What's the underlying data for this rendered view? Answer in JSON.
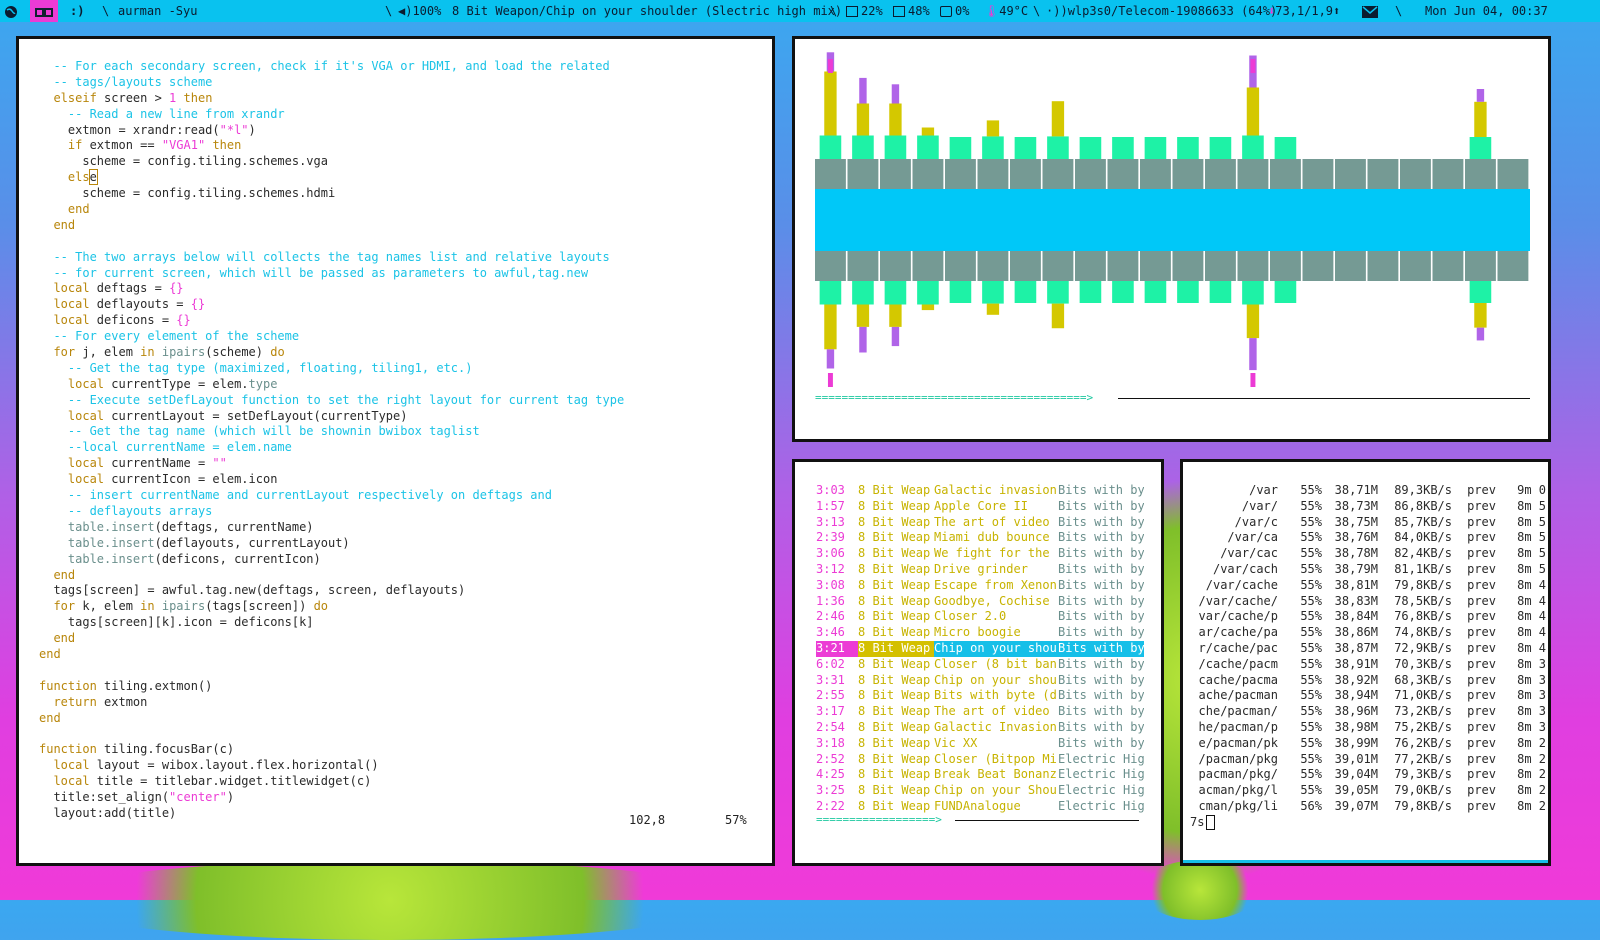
{
  "topbar": {
    "ws1_icon": "globe-icon",
    "ws2_icon": "glasses-icon",
    "ws3_text": ":)",
    "sep": "\\",
    "command": "aurman -Syu",
    "volume": "100%",
    "now_playing": "8 Bit Weapon/Chip on your shoulder (Slectric high mix)",
    "cpu": "22%",
    "mem": "48%",
    "swap": "0%",
    "temp": "49°C",
    "wifi": "wlp3s0/Telecom-19086633 (64%)",
    "net": "73,1/1,9",
    "date": "Mon Jun 04, 00:37",
    "accent_color": "#09c2ef",
    "active_ws_color": "#ec3bd5"
  },
  "editor": {
    "lines": [
      [
        [
          "c",
          "  -- For each secondary screen, check if it's VGA or HDMI, and load the related"
        ]
      ],
      [
        [
          "c",
          "  -- tags/layouts scheme"
        ]
      ],
      [
        [
          "k",
          "  elseif"
        ],
        [
          "t",
          " screen > "
        ],
        [
          "s",
          "1"
        ],
        [
          "t",
          " "
        ],
        [
          "k",
          "then"
        ]
      ],
      [
        [
          "c",
          "    -- Read a new line from xrandr"
        ]
      ],
      [
        [
          "t",
          "    extmon = xrandr:read("
        ],
        [
          "s",
          "\"*l\""
        ],
        [
          "t",
          ")"
        ]
      ],
      [
        [
          "k",
          "    if"
        ],
        [
          "t",
          " extmon == "
        ],
        [
          "s",
          "\"VGA1\""
        ],
        [
          "t",
          " "
        ],
        [
          "k",
          "then"
        ]
      ],
      [
        [
          "t",
          "      scheme = config.tiling.schemes.vga"
        ]
      ],
      [
        [
          "k",
          "    els"
        ],
        [
          "cur",
          "e"
        ]
      ],
      [
        [
          "t",
          "      scheme = config.tiling.schemes.hdmi"
        ]
      ],
      [
        [
          "k",
          "    end"
        ]
      ],
      [
        [
          "k",
          "  end"
        ]
      ],
      [
        [
          "t",
          ""
        ]
      ],
      [
        [
          "c",
          "  -- The two arrays below will collects the tag names list and relative layouts"
        ]
      ],
      [
        [
          "c",
          "  -- for current screen, which will be passed as parameters to awful,tag.new"
        ]
      ],
      [
        [
          "k",
          "  local"
        ],
        [
          "t",
          " deftags = "
        ],
        [
          "s",
          "{}"
        ]
      ],
      [
        [
          "k",
          "  local"
        ],
        [
          "t",
          " deflayouts = "
        ],
        [
          "s",
          "{}"
        ]
      ],
      [
        [
          "k",
          "  local"
        ],
        [
          "t",
          " deficons = "
        ],
        [
          "s",
          "{}"
        ]
      ],
      [
        [
          "c",
          "  -- For every element of the scheme"
        ]
      ],
      [
        [
          "k",
          "  for"
        ],
        [
          "t",
          " j, elem "
        ],
        [
          "k",
          "in"
        ],
        [
          "t",
          " "
        ],
        [
          "d",
          "ipairs"
        ],
        [
          "t",
          "(scheme) "
        ],
        [
          "k",
          "do"
        ]
      ],
      [
        [
          "c",
          "    -- Get the tag type (maximized, floating, tiling1, etc.)"
        ]
      ],
      [
        [
          "k",
          "    local"
        ],
        [
          "t",
          " currentType = elem."
        ],
        [
          "d",
          "type"
        ]
      ],
      [
        [
          "c",
          "    -- Execute setDefLayout function to set the right layout for current tag type"
        ]
      ],
      [
        [
          "k",
          "    local"
        ],
        [
          "t",
          " currentLayout = setDefLayout(currentType)"
        ]
      ],
      [
        [
          "c",
          "    -- Get the tag name (which will be shownin bwibox taglist"
        ]
      ],
      [
        [
          "c",
          "    --local currentName = elem.name"
        ]
      ],
      [
        [
          "k",
          "    local"
        ],
        [
          "t",
          " currentName = "
        ],
        [
          "s",
          "\"\""
        ]
      ],
      [
        [
          "k",
          "    local"
        ],
        [
          "t",
          " currentIcon = elem.icon"
        ]
      ],
      [
        [
          "c",
          "    -- insert currentName and currentLayout respectively on deftags and"
        ]
      ],
      [
        [
          "c",
          "    -- deflayouts arrays"
        ]
      ],
      [
        [
          "d",
          "    table.insert"
        ],
        [
          "t",
          "(deftags, currentName)"
        ]
      ],
      [
        [
          "d",
          "    table.insert"
        ],
        [
          "t",
          "(deflayouts, currentLayout)"
        ]
      ],
      [
        [
          "d",
          "    table.insert"
        ],
        [
          "t",
          "(deficons, currentIcon)"
        ]
      ],
      [
        [
          "k",
          "  end"
        ]
      ],
      [
        [
          "t",
          "  tags[screen] = awful.tag.new(deftags, screen, deflayouts)"
        ]
      ],
      [
        [
          "k",
          "  for"
        ],
        [
          "t",
          " k, elem "
        ],
        [
          "k",
          "in"
        ],
        [
          "t",
          " "
        ],
        [
          "d",
          "ipairs"
        ],
        [
          "t",
          "(tags[screen]) "
        ],
        [
          "k",
          "do"
        ]
      ],
      [
        [
          "t",
          "    tags[screen][k].icon = deficons[k]"
        ]
      ],
      [
        [
          "k",
          "  end"
        ]
      ],
      [
        [
          "k",
          "end"
        ]
      ],
      [
        [
          "t",
          ""
        ]
      ],
      [
        [
          "k",
          "function"
        ],
        [
          "t",
          " tiling.extmon()"
        ]
      ],
      [
        [
          "k",
          "  return"
        ],
        [
          "t",
          " extmon"
        ]
      ],
      [
        [
          "k",
          "end"
        ]
      ],
      [
        [
          "t",
          ""
        ]
      ],
      [
        [
          "k",
          "function"
        ],
        [
          "t",
          " tiling.focusBar(c)"
        ]
      ],
      [
        [
          "k",
          "  local"
        ],
        [
          "t",
          " layout = wibox.layout.flex.horizontal()"
        ]
      ],
      [
        [
          "k",
          "  local"
        ],
        [
          "t",
          " title = titlebar.widget.titlewidget(c)"
        ]
      ],
      [
        [
          "t",
          "  title:set_align("
        ],
        [
          "s",
          "\"center\""
        ],
        [
          "t",
          ")"
        ]
      ],
      [
        [
          "t",
          "  layout:add(title)"
        ]
      ]
    ],
    "position": "102,8",
    "percent": "57%"
  },
  "visualizer": {
    "progress_text": "=========================================>",
    "levels": [
      {
        "a": 0.9,
        "y": 0.9,
        "g": 0.42,
        "s": 0.25,
        "m": 0.25,
        "p": 0.7
      },
      {
        "a": 0.95,
        "y": 0.7,
        "g": 0.42,
        "s": 0.25,
        "m": 0.25,
        "p": 0.5
      },
      {
        "a": 0.9,
        "y": 0.7,
        "g": 0.42,
        "s": 0.25,
        "m": 0.25,
        "p": 0.4
      },
      {
        "a": 0.55,
        "y": 0.55,
        "g": 0.42,
        "s": 0.25,
        "m": 0.25,
        "p": 0.3
      },
      {
        "a": 0.5,
        "y": 0.5,
        "g": 0.42,
        "s": 0.25,
        "m": 0.2,
        "p": 0.2
      },
      {
        "a": 0.6,
        "y": 0.6,
        "g": 0.42,
        "s": 0.25,
        "m": 0.22,
        "p": 0.35
      },
      {
        "a": 0.48,
        "y": 0.48,
        "g": 0.42,
        "s": 0.25,
        "m": 0.2,
        "p": 0.2
      },
      {
        "a": 0.72,
        "y": 0.72,
        "g": 0.42,
        "s": 0.25,
        "m": 0.22,
        "p": 0.4
      },
      {
        "a": 0.5,
        "y": 0.5,
        "g": 0.42,
        "s": 0.25,
        "m": 0.2,
        "p": 0.22
      },
      {
        "a": 0.5,
        "y": 0.5,
        "g": 0.42,
        "s": 0.25,
        "m": 0.2,
        "p": 0.22
      },
      {
        "a": 0.48,
        "y": 0.48,
        "g": 0.42,
        "s": 0.25,
        "m": 0.2,
        "p": 0.28
      },
      {
        "a": 0.5,
        "y": 0.5,
        "g": 0.42,
        "s": 0.25,
        "m": 0.2,
        "p": 0.3
      },
      {
        "a": 0.48,
        "y": 0.48,
        "g": 0.42,
        "s": 0.25,
        "m": 0.2,
        "p": 0.22
      },
      {
        "a": 1.0,
        "y": 0.8,
        "g": 0.42,
        "s": 0.25,
        "m": 0.25,
        "p": 1.0
      },
      {
        "a": 0.48,
        "y": 0.48,
        "g": 0.42,
        "s": 0.25,
        "m": 0.2,
        "p": 0.22
      },
      {
        "a": 0.42,
        "y": 0.42,
        "g": 0.42,
        "s": 0.25,
        "m": 0.2,
        "p": 0.2
      },
      {
        "a": 0.42,
        "y": 0.42,
        "g": 0.42,
        "s": 0.25,
        "m": 0.2,
        "p": 0.2
      },
      {
        "a": 0.42,
        "y": 0.42,
        "g": 0.42,
        "s": 0.25,
        "m": 0.2,
        "p": 0.2
      },
      {
        "a": 0.42,
        "y": 0.42,
        "g": 0.42,
        "s": 0.25,
        "m": 0.2,
        "p": 0.2
      },
      {
        "a": 0.42,
        "y": 0.42,
        "g": 0.42,
        "s": 0.25,
        "m": 0.2,
        "p": 0.2
      },
      {
        "a": 0.85,
        "y": 0.72,
        "g": 0.42,
        "s": 0.25,
        "m": 0.2,
        "p": 0.42
      },
      {
        "a": 0.42,
        "y": 0.42,
        "g": 0.42,
        "s": 0.25,
        "m": 0.2,
        "p": 0.2
      }
    ]
  },
  "playlist": {
    "selected_index": 10,
    "rows": [
      {
        "time": "3:03",
        "artist": "8 Bit Weap",
        "title": "Galactic invasion",
        "album": "Bits with by"
      },
      {
        "time": "1:57",
        "artist": "8 Bit Weap",
        "title": "Apple Core II",
        "album": "Bits with by"
      },
      {
        "time": "3:13",
        "artist": "8 Bit Weap",
        "title": "The art of video",
        "album": "Bits with by"
      },
      {
        "time": "2:39",
        "artist": "8 Bit Weap",
        "title": "Miami dub bounce",
        "album": "Bits with by"
      },
      {
        "time": "3:06",
        "artist": "8 Bit Weap",
        "title": "We fight for the",
        "album": "Bits with by"
      },
      {
        "time": "3:12",
        "artist": "8 Bit Weap",
        "title": "Drive grinder",
        "album": "Bits with by"
      },
      {
        "time": "3:08",
        "artist": "8 Bit Weap",
        "title": "Escape from Xenon",
        "album": "Bits with by"
      },
      {
        "time": "1:36",
        "artist": "8 Bit Weap",
        "title": "Goodbye, Cochise",
        "album": "Bits with by"
      },
      {
        "time": "2:46",
        "artist": "8 Bit Weap",
        "title": "Closer 2.0",
        "album": "Bits with by"
      },
      {
        "time": "3:46",
        "artist": "8 Bit Weap",
        "title": "Micro boogie",
        "album": "Bits with by"
      },
      {
        "time": "3:21",
        "artist": "8 Bit Weap",
        "title": "Chip on your shou",
        "album": "Bits with by"
      },
      {
        "time": "6:02",
        "artist": "8 Bit Weap",
        "title": "Closer (8 bit ban",
        "album": "Bits with by"
      },
      {
        "time": "3:31",
        "artist": "8 Bit Weap",
        "title": "Chip on your shou",
        "album": "Bits with by"
      },
      {
        "time": "2:55",
        "artist": "8 Bit Weap",
        "title": "Bits with byte (d",
        "album": "Bits with by"
      },
      {
        "time": "3:17",
        "artist": "8 Bit Weap",
        "title": "The art of video",
        "album": "Bits with by"
      },
      {
        "time": "2:54",
        "artist": "8 Bit Weap",
        "title": "Galactic Invasion",
        "album": "Bits with by"
      },
      {
        "time": "3:18",
        "artist": "8 Bit Weap",
        "title": "Vic XX",
        "album": "Bits with by"
      },
      {
        "time": "2:52",
        "artist": "8 Bit Weap",
        "title": "Closer (Bitpop Mi",
        "album": "Electric Hig"
      },
      {
        "time": "4:25",
        "artist": "8 Bit Weap",
        "title": "Break Beat Bonanz",
        "album": "Electric Hig"
      },
      {
        "time": "3:25",
        "artist": "8 Bit Weap",
        "title": "Chip on your Shou",
        "album": "Electric Hig"
      },
      {
        "time": "2:22",
        "artist": "8 Bit Weap",
        "title": "FUNDAnalogue",
        "album": "Electric Hig"
      }
    ],
    "progress_text": "==================>"
  },
  "pacman": {
    "rows": [
      {
        "path": "/var",
        "pct": "55%",
        "size": "38,71M",
        "rate": "89,3KB/s",
        "prev": "prev",
        "eta": "9m 0"
      },
      {
        "path": "/var/",
        "pct": "55%",
        "size": "38,73M",
        "rate": "86,8KB/s",
        "prev": "prev",
        "eta": "8m 5"
      },
      {
        "path": "/var/c",
        "pct": "55%",
        "size": "38,75M",
        "rate": "85,7KB/s",
        "prev": "prev",
        "eta": "8m 5"
      },
      {
        "path": "/var/ca",
        "pct": "55%",
        "size": "38,76M",
        "rate": "84,0KB/s",
        "prev": "prev",
        "eta": "8m 5"
      },
      {
        "path": "/var/cac",
        "pct": "55%",
        "size": "38,78M",
        "rate": "82,4KB/s",
        "prev": "prev",
        "eta": "8m 5"
      },
      {
        "path": "/var/cach",
        "pct": "55%",
        "size": "38,79M",
        "rate": "81,1KB/s",
        "prev": "prev",
        "eta": "8m 5"
      },
      {
        "path": "/var/cache",
        "pct": "55%",
        "size": "38,81M",
        "rate": "79,8KB/s",
        "prev": "prev",
        "eta": "8m 4"
      },
      {
        "path": "/var/cache/",
        "pct": "55%",
        "size": "38,83M",
        "rate": "78,5KB/s",
        "prev": "prev",
        "eta": "8m 4"
      },
      {
        "path": "var/cache/p",
        "pct": "55%",
        "size": "38,84M",
        "rate": "76,8KB/s",
        "prev": "prev",
        "eta": "8m 4"
      },
      {
        "path": "ar/cache/pa",
        "pct": "55%",
        "size": "38,86M",
        "rate": "74,8KB/s",
        "prev": "prev",
        "eta": "8m 4"
      },
      {
        "path": "r/cache/pac",
        "pct": "55%",
        "size": "38,87M",
        "rate": "72,9KB/s",
        "prev": "prev",
        "eta": "8m 4"
      },
      {
        "path": "/cache/pacm",
        "pct": "55%",
        "size": "38,91M",
        "rate": "70,3KB/s",
        "prev": "prev",
        "eta": "8m 3"
      },
      {
        "path": "cache/pacma",
        "pct": "55%",
        "size": "38,92M",
        "rate": "68,3KB/s",
        "prev": "prev",
        "eta": "8m 3"
      },
      {
        "path": "ache/pacman",
        "pct": "55%",
        "size": "38,94M",
        "rate": "71,0KB/s",
        "prev": "prev",
        "eta": "8m 3"
      },
      {
        "path": "che/pacman/",
        "pct": "55%",
        "size": "38,96M",
        "rate": "73,2KB/s",
        "prev": "prev",
        "eta": "8m 3"
      },
      {
        "path": "he/pacman/p",
        "pct": "55%",
        "size": "38,98M",
        "rate": "75,2KB/s",
        "prev": "prev",
        "eta": "8m 3"
      },
      {
        "path": "e/pacman/pk",
        "pct": "55%",
        "size": "38,99M",
        "rate": "76,2KB/s",
        "prev": "prev",
        "eta": "8m 2"
      },
      {
        "path": "/pacman/pkg",
        "pct": "55%",
        "size": "39,01M",
        "rate": "77,2KB/s",
        "prev": "prev",
        "eta": "8m 2"
      },
      {
        "path": "pacman/pkg/",
        "pct": "55%",
        "size": "39,04M",
        "rate": "79,3KB/s",
        "prev": "prev",
        "eta": "8m 2"
      },
      {
        "path": "acman/pkg/l",
        "pct": "55%",
        "size": "39,05M",
        "rate": "79,0KB/s",
        "prev": "prev",
        "eta": "8m 2"
      },
      {
        "path": "cman/pkg/li",
        "pct": "56%",
        "size": "39,07M",
        "rate": "79,8KB/s",
        "prev": "prev",
        "eta": "8m 2"
      }
    ],
    "prompt": "7s"
  }
}
